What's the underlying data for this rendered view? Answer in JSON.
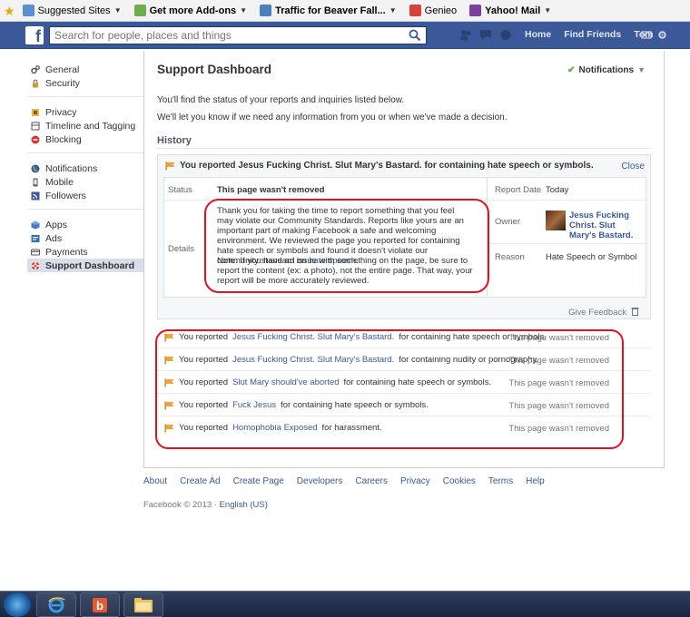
{
  "favorites": [
    {
      "label": "Suggested Sites",
      "has_menu": true
    },
    {
      "label": "Get more Add-ons",
      "has_menu": true
    },
    {
      "label": "Traffic for Beaver Fall...",
      "has_menu": true
    },
    {
      "label": "Genieo",
      "has_menu": false
    },
    {
      "label": "Yahoo! Mail",
      "has_menu": true
    }
  ],
  "topbar": {
    "logo": "f",
    "search_placeholder": "Search for people, places and things",
    "nav": [
      "Home",
      "Find Friends",
      "Tom"
    ]
  },
  "sidebar": {
    "groups": [
      [
        {
          "label": "General",
          "icon": "gear-icon"
        },
        {
          "label": "Security",
          "icon": "lock-icon"
        }
      ],
      [
        {
          "label": "Privacy",
          "icon": "privacy-icon"
        },
        {
          "label": "Timeline and Tagging",
          "icon": "timeline-icon"
        },
        {
          "label": "Blocking",
          "icon": "block-icon"
        }
      ],
      [
        {
          "label": "Notifications",
          "icon": "globe-icon"
        },
        {
          "label": "Mobile",
          "icon": "mobile-icon"
        },
        {
          "label": "Followers",
          "icon": "rss-icon"
        }
      ],
      [
        {
          "label": "Apps",
          "icon": "apps-icon"
        },
        {
          "label": "Ads",
          "icon": "ads-icon"
        },
        {
          "label": "Payments",
          "icon": "card-icon"
        },
        {
          "label": "Support Dashboard",
          "icon": "lifebuoy-icon",
          "active": true
        }
      ]
    ]
  },
  "main": {
    "title": "Support Dashboard",
    "notifications_label": "Notifications",
    "intro1": "You'll find the status of your reports and inquiries listed below.",
    "intro2": "We'll let you know if we need any information from you or when we've made a decision.",
    "history_label": "History",
    "expanded": {
      "header": "You reported Jesus Fucking Christ. Slut Mary's Bastard. for containing hate speech or symbols.",
      "close_label": "Close",
      "status_label": "Status",
      "status_value": "This page wasn't removed",
      "details_label": "Details",
      "details_para1": "Thank you for taking the time to report something that you feel may violate our Community Standards. Reports like yours are an important part of making Facebook a safe and welcoming environment. We reviewed the page you reported for containing hate speech or symbols and found it doesn't violate our community standard on",
      "details_link": "hate speech",
      "details_para2": "Note: If you have an issue with something on the page, be sure to report the content (ex: a photo), not the entire page. That way, your report will be more accurately reviewed.",
      "report_date_label": "Report Date",
      "report_date_value": "Today",
      "owner_label": "Owner",
      "owner_name": "Jesus Fucking Christ. Slut Mary's Bastard.",
      "reason_label": "Reason",
      "reason_value": "Hate Speech or Symbol",
      "give_feedback": "Give Feedback"
    },
    "reports": [
      {
        "prefix": "You reported",
        "target": "Jesus Fucking Christ. Slut Mary's Bastard.",
        "suffix": "for containing hate speech or symbols.",
        "status": "This page wasn't removed"
      },
      {
        "prefix": "You reported",
        "target": "Jesus Fucking Christ. Slut Mary's Bastard.",
        "suffix": "for containing nudity or pornography.",
        "status": "This page wasn't removed"
      },
      {
        "prefix": "You reported",
        "target": "Slut Mary should've aborted",
        "suffix": "for containing hate speech or symbols.",
        "status": "This page wasn't removed"
      },
      {
        "prefix": "You reported",
        "target": "Fuck Jesus",
        "suffix": "for containing hate speech or symbols.",
        "status": "This page wasn't removed"
      },
      {
        "prefix": "You reported",
        "target": "Homophobia Exposed",
        "suffix": "for harassment.",
        "status": "This page wasn't removed"
      }
    ]
  },
  "footer": {
    "links": [
      "About",
      "Create Ad",
      "Create Page",
      "Developers",
      "Careers",
      "Privacy",
      "Cookies",
      "Terms",
      "Help"
    ],
    "copyright": "Facebook © 2013 ·",
    "language": "English (US)"
  },
  "colors": {
    "fb_blue": "#3b5998",
    "annotation_red": "#e8101f"
  }
}
